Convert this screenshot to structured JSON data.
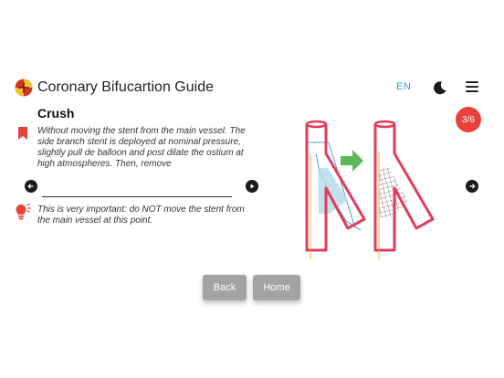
{
  "header": {
    "title": "Coronary Bifucartion Guide",
    "language": "EN",
    "icons": {
      "logo": "app-logo",
      "theme": "moon-icon",
      "menu": "hamburger-menu-icon"
    }
  },
  "step": {
    "title": "Crush",
    "description": "Without moving the stent from the main vessel. The side branch stent is deployed at nominal pressure, slightly pull de balloon and post dilate the ostium at high atmospheres. Then, remove",
    "note": "This is very important: do NOT move the stent from the main vessel at this point.",
    "progress": "3/6"
  },
  "buttons": {
    "back": "Back",
    "home": "Home"
  },
  "colors": {
    "accent_red": "#e8413c",
    "link_blue": "#3a9ad9",
    "arrow_green": "#5cb85c",
    "vessel_red": "#e23c5a",
    "button_gray": "#a3a3a3"
  }
}
